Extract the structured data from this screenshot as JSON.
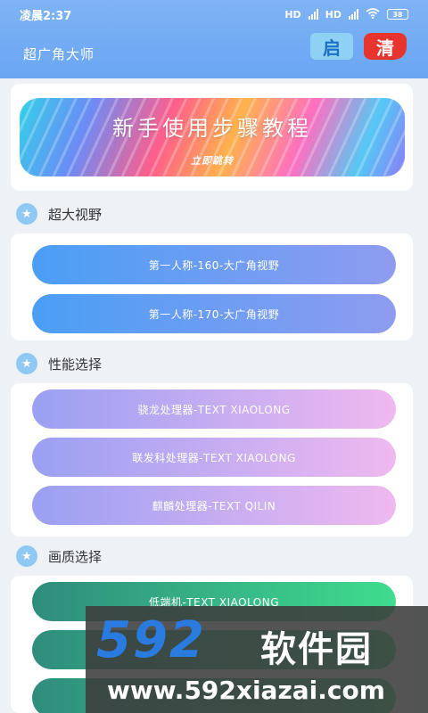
{
  "status_bar": {
    "time": "凌晨2:37",
    "signal_label": "HD",
    "battery": "38"
  },
  "header": {
    "title": "超广角大师",
    "btn_qi": "启",
    "btn_qing": "清"
  },
  "banner": {
    "title": "新手使用步骤教程",
    "subtitle": "立即跳转"
  },
  "sections": [
    {
      "title": "超大视野",
      "options": [
        "第一人称-160-大广角视野",
        "第一人称-170-大广角视野"
      ]
    },
    {
      "title": "性能选择",
      "options": [
        "骁龙处理器-TEXT XIAOLONG",
        "联发科处理器-TEXT XIAOLONG",
        "麒麟处理器-TEXT QILIN"
      ]
    },
    {
      "title": "画质选择",
      "options": [
        "低端机-TEXT XIAOLONG"
      ]
    }
  ],
  "watermark": {
    "logo": "592",
    "text": "软件园",
    "url": "www.592xiazai.com"
  }
}
